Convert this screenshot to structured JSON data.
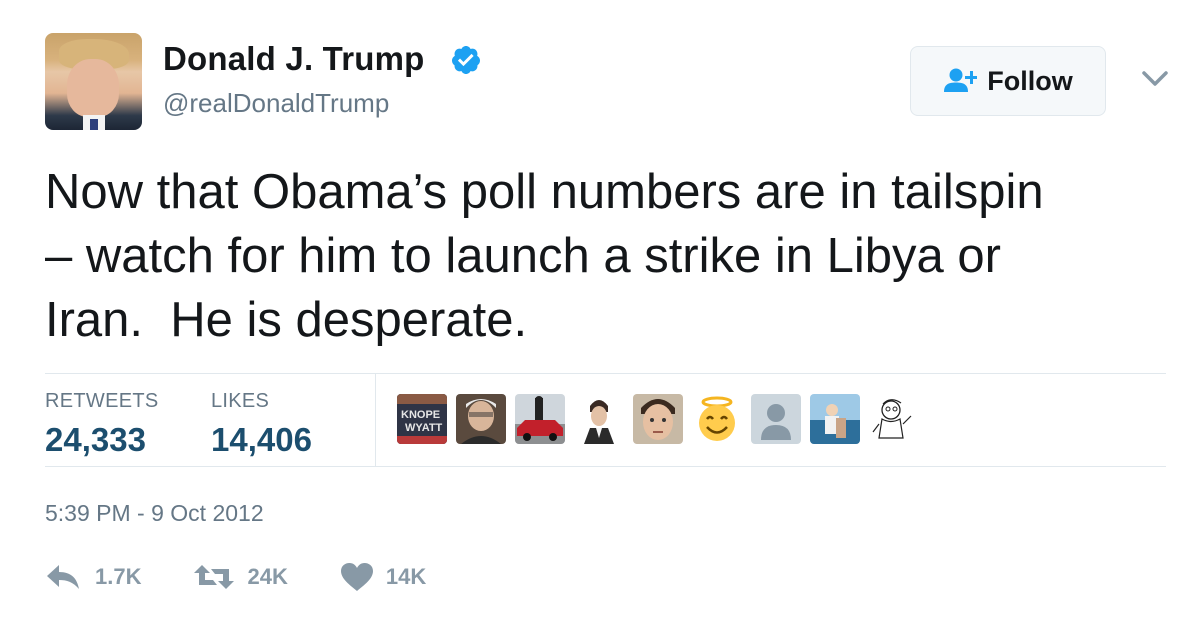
{
  "author": {
    "name": "Donald J. Trump",
    "handle": "@realDonaldTrump",
    "verified": true
  },
  "follow_button": {
    "label": "Follow",
    "icon": "add-user-icon"
  },
  "menu": {
    "icon": "chevron-down-icon"
  },
  "tweet": {
    "text": "Now that Obama’s poll numbers are in tailspin\n– watch for him to launch a strike in Libya or\nIran.  He is desperate."
  },
  "stats": {
    "retweets": {
      "label": "RETWEETS",
      "value": "24,333"
    },
    "likes": {
      "label": "LIKES",
      "value": "14,406"
    }
  },
  "likers": {
    "first_avatar_text": [
      "KNOPE",
      "WYATT"
    ],
    "avatars": [
      "poster-avatar",
      "man-photo-avatar",
      "car-photo-avatar",
      "suit-avatar",
      "man-face-avatar",
      "angel-emoji-avatar",
      "default-avatar",
      "beach-avatar",
      "sketch-avatar"
    ]
  },
  "timestamp": "5:39 PM - 9 Oct 2012",
  "actions": {
    "reply": {
      "count": "1.7K",
      "icon": "reply-icon"
    },
    "retweet": {
      "count": "24K",
      "icon": "retweet-icon"
    },
    "like": {
      "count": "14K",
      "icon": "heart-icon"
    }
  },
  "colors": {
    "verified": "#1da1f2",
    "follow_icon": "#1da1f2",
    "stat_value": "#1c4e6e",
    "muted": "#657786",
    "action_gray": "#8899a6"
  }
}
